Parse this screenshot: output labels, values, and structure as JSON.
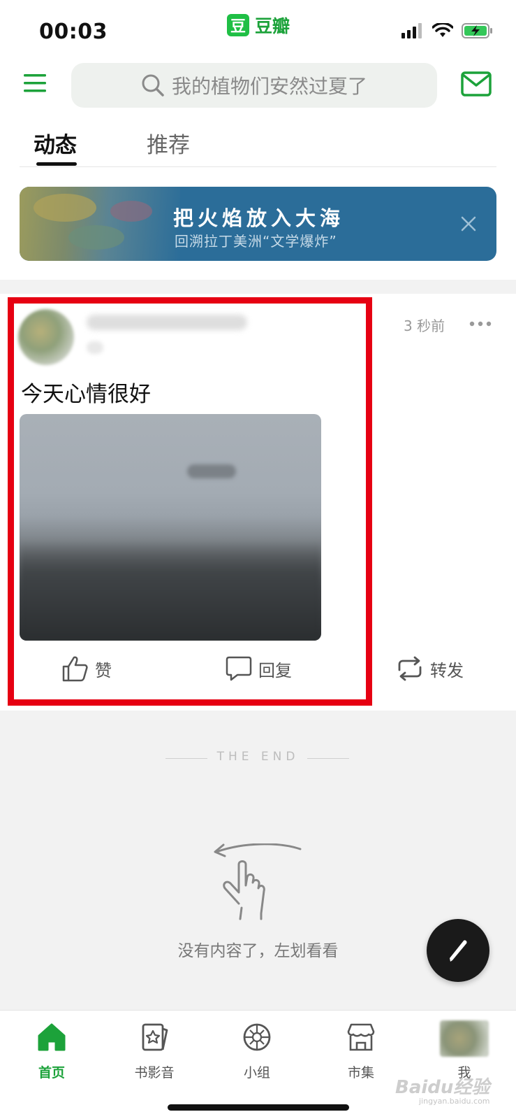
{
  "status_bar": {
    "time": "00:03",
    "app_brand_logo": "豆",
    "app_brand_name": "豆瓣"
  },
  "header": {
    "search_placeholder": "我的植物们安然过夏了"
  },
  "tabs": [
    {
      "label": "动态",
      "active": true
    },
    {
      "label": "推荐",
      "active": false
    }
  ],
  "banner": {
    "title": "把火焰放入大海",
    "subtitle": "回溯拉丁美洲“文学爆炸”"
  },
  "post": {
    "time_ago": "3 秒前",
    "text": "今天心情很好",
    "actions": {
      "like": "赞",
      "reply": "回复",
      "share": "转发"
    }
  },
  "feed_end": {
    "end_marker": "THE END",
    "empty_hint": "没有内容了，左划看看"
  },
  "tab_bar": [
    {
      "label": "首页",
      "icon": "home-icon",
      "active": true
    },
    {
      "label": "书影音",
      "icon": "book-movie-music-icon",
      "active": false
    },
    {
      "label": "小组",
      "icon": "group-icon",
      "active": false
    },
    {
      "label": "市集",
      "icon": "market-icon",
      "active": false
    },
    {
      "label": "我",
      "icon": "profile-avatar",
      "active": false
    }
  ],
  "watermark": {
    "brand": "Baidu经验",
    "domain": "jingyan.baidu.com"
  },
  "colors": {
    "brand_green": "#1ca23a",
    "banner_blue": "#2b6d99",
    "highlight_red": "#e60012"
  }
}
